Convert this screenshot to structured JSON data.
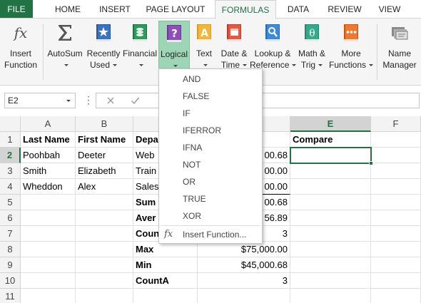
{
  "ribbon": {
    "tabs": [
      "FILE",
      "HOME",
      "INSERT",
      "PAGE LAYOUT",
      "FORMULAS",
      "DATA",
      "REVIEW",
      "VIEW"
    ],
    "active_tab": "FORMULAS",
    "accent": "#217346",
    "buttons": {
      "insert_function": {
        "line1": "Insert",
        "line2": "Function",
        "icon": "fx-icon"
      },
      "autosum": {
        "line1": "AutoSum",
        "icon": "sigma-icon"
      },
      "recently_used": {
        "line1": "Recently",
        "line2": "Used",
        "icon": "star-book-icon"
      },
      "financial": {
        "line1": "Financial",
        "icon": "coins-book-icon"
      },
      "logical": {
        "line1": "Logical",
        "icon": "question-book-icon"
      },
      "text": {
        "line1": "Text",
        "icon": "text-book-icon"
      },
      "date_time": {
        "line1": "Date &",
        "line2": "Time",
        "icon": "calendar-book-icon"
      },
      "lookup_reference": {
        "line1": "Lookup &",
        "line2": "Reference",
        "icon": "magnifier-book-icon"
      },
      "math_trig": {
        "line1": "Math &",
        "line2": "Trig",
        "icon": "theta-book-icon"
      },
      "more_functions": {
        "line1": "More",
        "line2": "Functions",
        "icon": "more-book-icon"
      },
      "name_manager": {
        "line1": "Name",
        "line2": "Manager",
        "icon": "tags-icon"
      }
    }
  },
  "formula_bar": {
    "name_box": "E2",
    "cancel_icon": "x-icon",
    "enter_icon": "check-icon",
    "formula": ""
  },
  "sheet": {
    "columns": [
      "A",
      "B",
      "C",
      "D",
      "E",
      "F"
    ],
    "rows": [
      "1",
      "2",
      "3",
      "4",
      "5",
      "6",
      "7",
      "8",
      "9",
      "10",
      "11"
    ],
    "selected_cell": "E2",
    "cells": {
      "A1": "Last Name",
      "B1": "First Name",
      "C1": "Depa",
      "E1": "Compare",
      "A2": "Poohbah",
      "B2": "Deeter",
      "C2": "Web",
      "D2": "00.68",
      "A3": "Smith",
      "B3": "Elizabeth",
      "C3": "Train",
      "D3": "00.00",
      "A4": "Wheddon",
      "B4": "Alex",
      "C4": "Sales",
      "D4": "00.00",
      "C5": "Sum",
      "D5": "00.68",
      "C6": "Aver",
      "D6": "56.89",
      "C7": "Coun",
      "D7": "3",
      "C8": "Max",
      "D8": "$75,000.00",
      "C9": "Min",
      "D9": "$45,000.68",
      "C10": "CountA",
      "D10": "3"
    }
  },
  "logical_menu": {
    "items": [
      "AND",
      "FALSE",
      "IF",
      "IFERROR",
      "IFNA",
      "NOT",
      "OR",
      "TRUE",
      "XOR"
    ],
    "insert_function": "Insert Function...",
    "insert_function_icon": "fx-icon"
  }
}
